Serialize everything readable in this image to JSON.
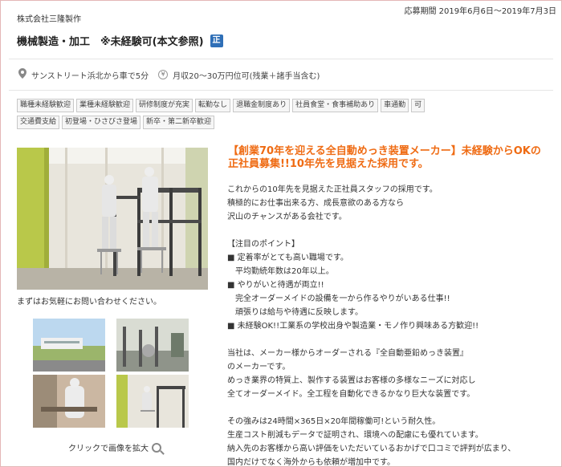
{
  "header": {
    "period": "応募期間 2019年6月6日～2019年7月3日",
    "company": "株式会社三隆製作",
    "job_title": "機械製造・加工　※未経験可(本文参照)",
    "badge": "正"
  },
  "meta": {
    "location_icon": "map-pin-icon",
    "location": "サンストリート浜北から車で5分",
    "salary_icon": "yen-icon",
    "salary_icon_glyph": "¥",
    "salary": "月収20～30万円位可(残業＋諸手当含む)"
  },
  "tags": [
    "職種未経験歓迎",
    "業種未経験歓迎",
    "研修制度が充実",
    "転勤なし",
    "退職金制度あり",
    "社員食堂・食事補助あり",
    "車通勤",
    "可",
    "交通費支給",
    "初登場・ひさびさ登場",
    "新卒・第二新卒歓迎"
  ],
  "photos": {
    "caption": "まずはお気軽にお問い合わせください。",
    "zoom_label": "クリックで画像を拡大"
  },
  "article": {
    "headline": "【創業70年を迎える全自動めっき装置メーカー】未経験からOKの正社員募集!!10年先を見据えた採用です。",
    "lines": [
      "これからの10年先を見据えた正社員スタッフの採用です。",
      "積極的にお仕事出来る方、成長意欲のある方なら",
      "沢山のチャンスがある会社です。",
      "",
      "【注目のポイント】",
      "■ 定着率がとても高い職場です。",
      "　平均勤続年数は20年以上。",
      "■ やりがいと待遇が両立!!",
      "　完全オーダーメイドの設備を一から作るやりがいある仕事!!",
      "　頑張りは給与や待遇に反映します。",
      "■ 未経験OK!!工業系の学校出身や製造業・モノ作り興味ある方歓迎!!",
      "",
      "当社は、メーカー様からオーダーされる『全自動亜鉛めっき装置』",
      "のメーカーです。",
      "めっき業界の特質上、製作する装置はお客様の多様なニーズに対応し",
      "全てオーダーメイド。全工程を自動化できるかなり巨大な装置です。",
      "",
      "その強みは24時間×365日×20年間稼働可!という耐久性。",
      "生産コスト削減もデータで証明され、環境への配慮にも優れています。",
      "納入先のお客様から高い評価をいただいているおかげで口コミで評判が広まり、",
      "国内だけでなく海外からも依頼が増加中です。"
    ]
  },
  "colors": {
    "accent": "#ef6b13",
    "badge": "#2f6fb7"
  }
}
